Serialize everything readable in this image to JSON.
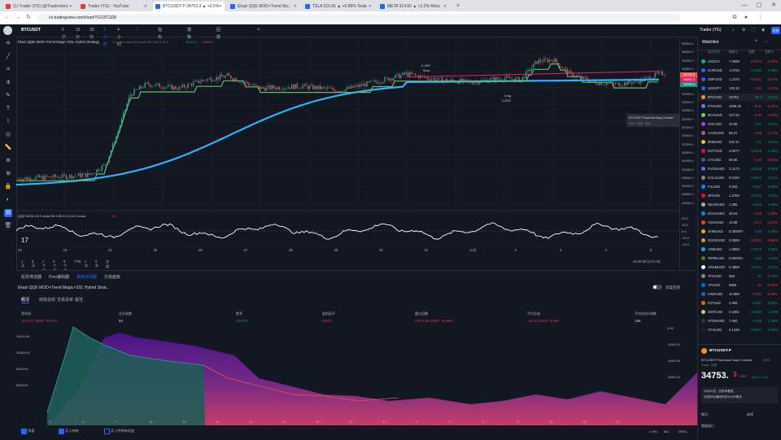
{
  "browser": {
    "tabs": [
      {
        "label": "(1) Trader (YG) (@Tradersfun)",
        "color": "#e53935",
        "active": false
      },
      {
        "label": "Trader (YG) - YouTube",
        "color": "#e53935",
        "active": false
      },
      {
        "label": "BTCUSDT.P 34753.3 ▲ +0.5%",
        "color": "#2962ff",
        "active": true
      },
      {
        "label": "Ekazi QQE MOD+Trend Ma...",
        "color": "#2962ff",
        "active": false
      },
      {
        "label": "TSLA 219.96 ▲ +0.86% Tesla",
        "color": "#2962ff",
        "active": false
      },
      {
        "label": "META 314.60 ▲ +1.2% Meta",
        "color": "#2962ff",
        "active": false
      }
    ],
    "new_tab": "+",
    "url": "cn.tradingview.com/chart/YGC8T2Z8/"
  },
  "toolbar": {
    "symbol": "BTCUSDT",
    "intervals": [
      "5分",
      "15分",
      "30分",
      "1小时",
      "4小时"
    ],
    "active_interval": "1小时",
    "items": [
      "指标",
      "模板",
      "回放"
    ],
    "layout_name": "Trader (YG)",
    "publish": "发布"
  },
  "chart": {
    "legend": "Ekazi QQE MOD+Trend Magic+SSL Hybrid Strategy",
    "legend_vals": "4 5 1 41 close 50 close 200 200 3 14 3",
    "legend_nums": [
      "34661.2",
      "33956.9"
    ],
    "annotation_short": "Short",
    "annotation_short_val": "-0.1087",
    "annotation_long": "Long",
    "annotation_long_val": "0.4322",
    "tooltip_title": "BTCUSDT Perpetual Swap Contract",
    "tooltip_line": "OKX · 加密 · 永续",
    "price_ticks": [
      "36000.0",
      "35600.0",
      "35200.0",
      "34800.0",
      "34400.0",
      "34000.0",
      "33600.0",
      "33200.0",
      "32800.0",
      "32400.0",
      "32000.0",
      "31600.0",
      "31200.0",
      "30800.0",
      "30400.0",
      "30000.0",
      "29600.0",
      "29200.0",
      "28800.0",
      "28400.0"
    ],
    "price_labels": [
      {
        "text": "34753.3",
        "color": "#ef5350"
      },
      {
        "text": "34661.2",
        "color": "#e91e63"
      },
      {
        "text": "33956.9",
        "color": "#089981"
      }
    ],
    "osc_legend": "QQE MOD 6 5 3 close 50 0.35 6 5 1.61 3 close",
    "osc_val": "-8.3",
    "osc_ticks": [
      "20.0",
      "10.0",
      "0.0",
      "-10.0",
      "-20.0"
    ],
    "date_ticks": [
      "22",
      "23",
      "24",
      "25",
      "26",
      "27",
      "28",
      "29",
      "30",
      "31",
      "11月",
      "2",
      "3",
      "4",
      "5"
    ],
    "time_readout": "20:40:30 (UTC+8)",
    "ranges": [
      "1天",
      "5天",
      "1个月",
      "3个月",
      "6个月",
      "YTD",
      "1年",
      "5年",
      "全部"
    ],
    "logo": "17"
  },
  "panel": {
    "tabs": [
      "股票筛选器",
      "Pine编辑器",
      "策略测试器",
      "交易面板"
    ],
    "active_tab": "策略测试器",
    "strategy": "Ekazi QQE MOD+Trend Magic+SSL Hybrid Strat...",
    "subtabs": [
      "概况",
      "绩效总结",
      "交易清单",
      "属性"
    ],
    "toggle_label": "深度回测",
    "stats": [
      {
        "label": "净利润",
        "value": "-977.17 USDT  -9.77%",
        "color": "#f23645"
      },
      {
        "label": "总交易数",
        "value": "54",
        "color": "#d1d4dc"
      },
      {
        "label": "胜率",
        "value": "24.07%",
        "color": "#089981"
      },
      {
        "label": "盈利因子",
        "value": "0.672",
        "color": "#f23645"
      },
      {
        "label": "最大回撤",
        "value": "4 971.04 USDT  -8.39%",
        "color": "#f23645"
      },
      {
        "label": "平均交易",
        "value": "-18.10 USDT  -0.9%",
        "color": "#f23645"
      },
      {
        "label": "平均持仓K线数",
        "value": "156",
        "color": "#d1d4dc"
      }
    ],
    "left_ticks": [
      "11000.00",
      "10000.00",
      "9000.00",
      "8000.00"
    ],
    "right_ticks": [
      "0.00",
      "-2000.00",
      "-4000.00",
      "-6000.00"
    ],
    "dates": [
      "1",
      "4",
      "7",
      "10",
      "13",
      "16",
      "19",
      "22",
      "25",
      "28",
      "31",
      "3",
      "6",
      "9",
      "12",
      "15",
      "18",
      "21"
    ],
    "legend": [
      "净值",
      "买入持有",
      "买入并持有权益"
    ],
    "bottom_right": [
      "1.0Hz",
      "MA",
      "MSSL"
    ]
  },
  "watchlist": {
    "title": "Watchlist",
    "headers": [
      "商品代码",
      "最新价",
      "涨跌",
      "涨跌%"
    ],
    "rows": [
      {
        "sym": "USDCX",
        "price": "7.2999",
        "chg": "-0.0073",
        "pct": "-0.10%",
        "up": false,
        "dot": "#26a69a"
      },
      {
        "sym": "EURUSD",
        "price": "1.0725",
        "chg": "0.0052",
        "pct": "0.49%",
        "up": true,
        "dot": "#2962ff"
      },
      {
        "sym": "GBPUSD",
        "price": "1.2275",
        "chg": "-0.0021",
        "pct": "-0.17%",
        "up": false,
        "dot": "#2962ff"
      },
      {
        "sym": "USDJPY",
        "price": "149.32",
        "chg": "-1.80",
        "pct": "-1.19%",
        "up": false,
        "dot": "#2962ff"
      },
      {
        "sym": "BTCUSD",
        "price": "34753",
        "chg": "38.3",
        "pct": "0.11%",
        "up": true,
        "dot": "#f7931a"
      },
      {
        "sym": "ETHUSD",
        "price": "1838.32",
        "chg": "-6.34",
        "pct": "-0.34%",
        "up": false,
        "dot": "#627eea"
      },
      {
        "sym": "BCHUSD",
        "price": "227.53",
        "chg": "-2.40",
        "pct": "-1.04%",
        "up": false,
        "dot": "#8dc351"
      },
      {
        "sym": "SOLUSD",
        "price": "40.95",
        "chg": "1.21",
        "pct": "3.04%",
        "up": true,
        "dot": "#9945ff"
      },
      {
        "sym": "AAVEUSD",
        "price": "89.27",
        "chg": "-1.55",
        "pct": "-1.71%",
        "up": false,
        "dot": "#b6509e"
      },
      {
        "sym": "BNBUSD",
        "price": "231.91",
        "chg": "1.41",
        "pct": "0.61%",
        "up": true,
        "dot": "#f3ba2f"
      },
      {
        "sym": "DOTUSD",
        "price": "4.6977",
        "chg": "0.0216",
        "pct": "0.46%",
        "up": true,
        "dot": "#e6007a"
      },
      {
        "sym": "LTCUSD",
        "price": "69.85",
        "chg": "-0.45",
        "pct": "-0.64%",
        "up": false,
        "dot": "#345d9d"
      },
      {
        "sym": "DYDXUSD",
        "price": "2.3173",
        "chg": "0.0219",
        "pct": "0.95%",
        "up": true,
        "dot": "#6966ff"
      },
      {
        "sym": "GALAUSD",
        "price": "0.0192",
        "chg": "0.0004",
        "pct": "2.13%",
        "up": true,
        "dot": "#888888"
      },
      {
        "sym": "FILUSD",
        "price": "3.943",
        "chg": "0.037",
        "pct": "0.95%",
        "up": true,
        "dot": "#0090ff"
      },
      {
        "sym": "OPUSD",
        "price": "1.4760",
        "chg": "0.0475",
        "pct": "3.32%",
        "up": true,
        "dot": "#ff0420"
      },
      {
        "sym": "NEARUSD",
        "price": "1.395",
        "chg": "0.015",
        "pct": "1.09%",
        "up": true,
        "dot": "#aaaaaa"
      },
      {
        "sym": "DASHUSD",
        "price": "29.54",
        "chg": "-0.59",
        "pct": "-1.96%",
        "up": false,
        "dot": "#008ce7"
      },
      {
        "sym": "AVAXUSD",
        "price": "10.98",
        "chg": "-0.17",
        "pct": "-1.52%",
        "up": false,
        "dot": "#e84142"
      },
      {
        "sym": "SHIBUSD",
        "price": "0.000007",
        "chg": "0.00",
        "pct": "0.29%",
        "up": true,
        "dot": "#ffa409"
      },
      {
        "sym": "DOGEUSD",
        "price": "0.0669",
        "chg": "-0.0004",
        "pct": "-0.60%",
        "up": false,
        "dot": "#c2a633"
      },
      {
        "sym": "ARBUSD",
        "price": "1.0859",
        "chg": "0.0274",
        "pct": "2.59%",
        "up": true,
        "dot": "#28a0f0"
      },
      {
        "sym": "PEPEUSD",
        "price": "0.000001",
        "chg": "0.00",
        "pct": "1.20%",
        "up": true,
        "dot": "#3d8130"
      },
      {
        "sym": "ARKMUSD",
        "price": "0.3889",
        "chg": "0.0122",
        "pct": "3.24%",
        "up": true,
        "dot": "#ffffff"
      },
      {
        "sym": "TFXUSD",
        "price": "556",
        "chg": "20",
        "pct": "3.73%",
        "up": true,
        "dot": "#888888"
      },
      {
        "sym": "YFIUSD",
        "price": "5906",
        "chg": "-31",
        "pct": "-0.52%",
        "up": false,
        "dot": "#006ae3"
      },
      {
        "sym": "LINKUSD",
        "price": "10.895",
        "chg": "-0.094",
        "pct": "-0.86%",
        "up": false,
        "dot": "#2a5ada"
      },
      {
        "sym": "ICPUSD",
        "price": "3.996",
        "chg": "0.021",
        "pct": "0.53%",
        "up": true,
        "dot": "#f15a24"
      },
      {
        "sym": "GMTUSD",
        "price": "0.1961",
        "chg": "0.0023",
        "pct": "1.19%",
        "up": true,
        "dot": "#e5c07b"
      },
      {
        "sym": "ATOMUSD",
        "price": "7.952",
        "chg": "0.106",
        "pct": "1.35%",
        "up": true,
        "dot": "#2e3148"
      },
      {
        "sym": "CFXUSD",
        "price": "0.1346",
        "chg": "0.0027",
        "pct": "2.05%",
        "up": true,
        "dot": "#1f1f1f"
      }
    ],
    "detail": {
      "symbol": "BTCUSDT.P",
      "subtitle": "BTCUSDT Perpetual Swap Contract",
      "exchange": "OKX",
      "type": "Swap · 加密",
      "price": "34753.",
      "price_small": "3",
      "unit": "USDT",
      "change": "38.3  0.11%",
      "news": "10月31日 · 比特币看涨",
      "news_line2": "比特币价格回升至34,000美元",
      "bottom": [
        "概况",
        "新闻"
      ],
      "bottom2": "数据窗口"
    }
  }
}
